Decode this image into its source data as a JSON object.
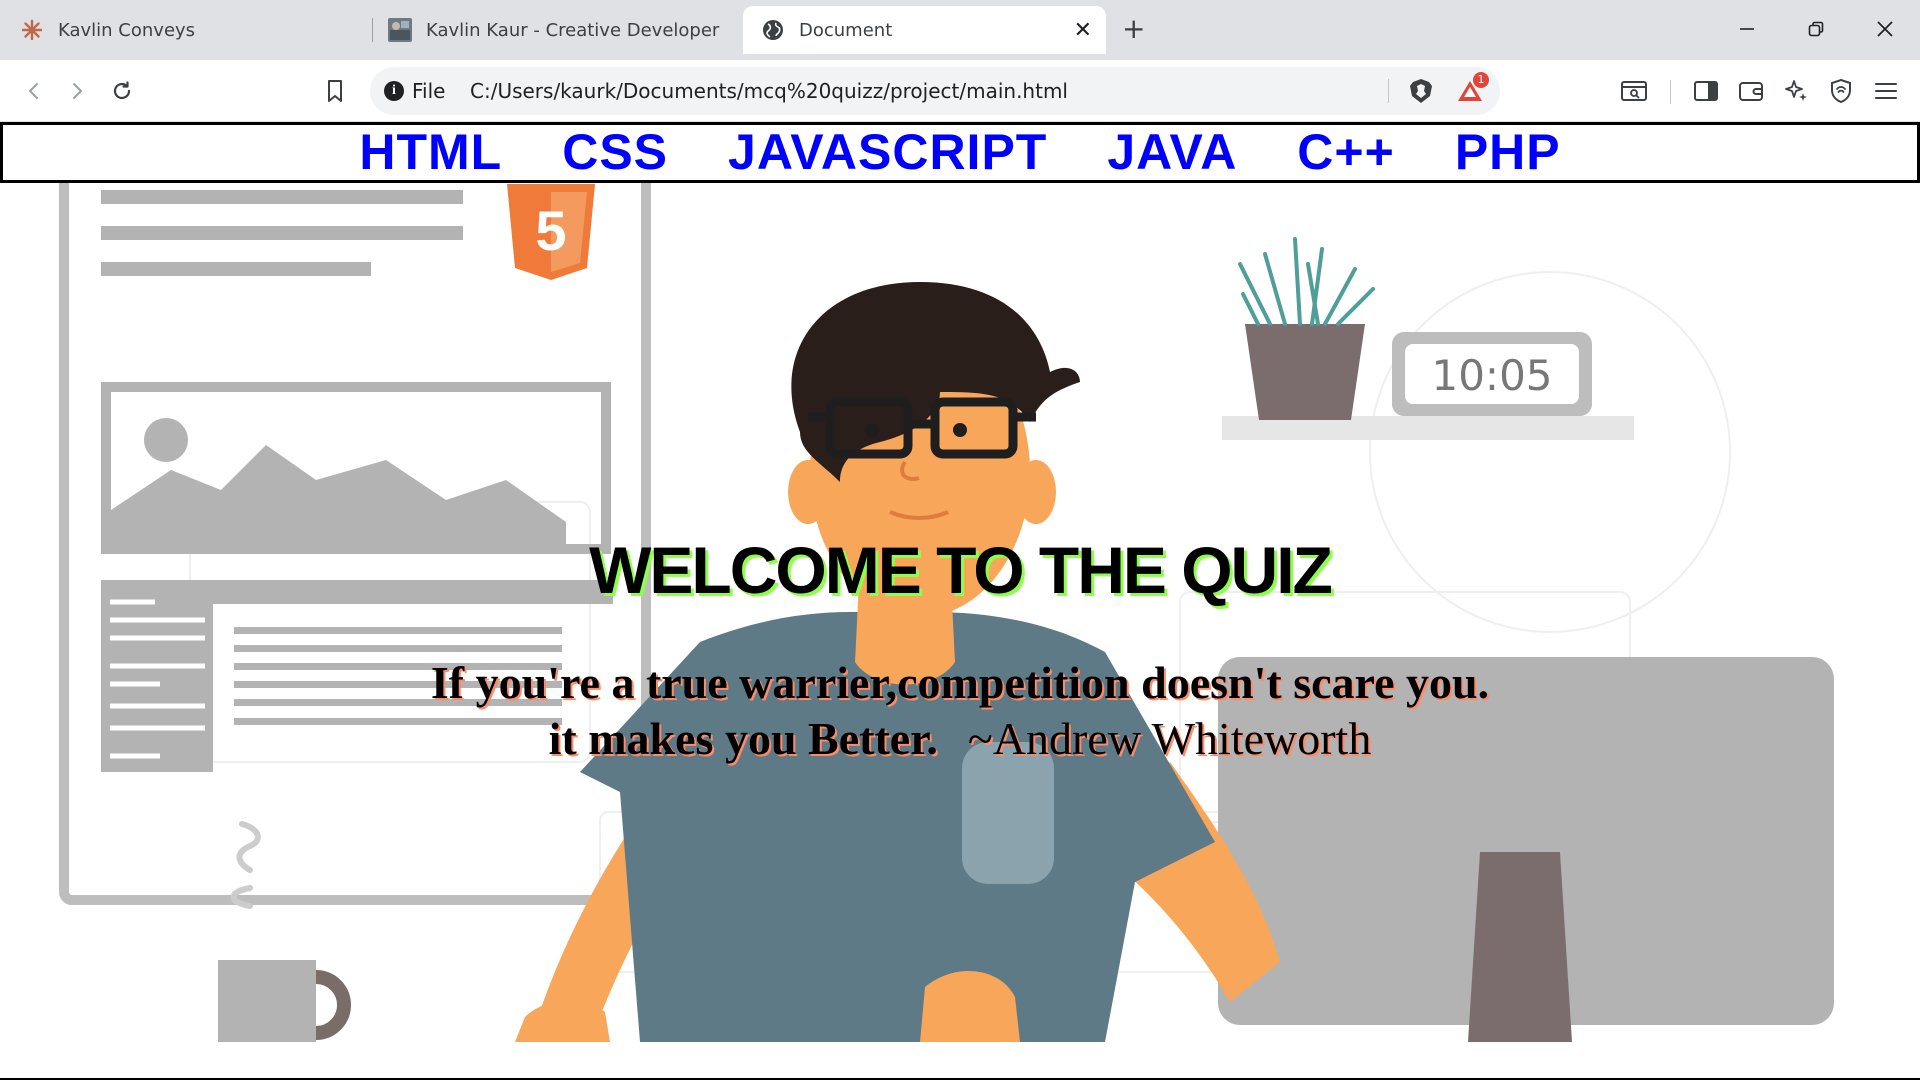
{
  "browser": {
    "tabs": [
      {
        "title": "Kavlin Conveys",
        "icon": "sunburst-icon"
      },
      {
        "title": "Kavlin Kaur - Creative Developer & Pr",
        "icon": "thumbnail-icon"
      },
      {
        "title": "Document",
        "icon": "globe-icon",
        "active": true
      }
    ],
    "new_tab_label": "+",
    "address": {
      "scheme_label": "File",
      "url": "C:/Users/kaurk/Documents/mcq%20quizz/project/main.html"
    },
    "notification_count": "1"
  },
  "page": {
    "nav_links": [
      "HTML",
      "CSS",
      "JAVASCRIPT",
      "JAVA",
      "C++",
      "PHP"
    ],
    "title": "WELCOME TO THE QUIZ",
    "quote_line1": "If you're a true warrier,competition doesn't scare you.",
    "quote_line2": "it makes you Better.",
    "quote_author": "~Andrew Whiteworth",
    "illustration": {
      "clock_text": "10:05",
      "badge_text": "5"
    },
    "colors": {
      "nav_link": "#0000ff",
      "title_shadow": "#8cff4a",
      "quote_shadow": "#ff8a65"
    }
  }
}
